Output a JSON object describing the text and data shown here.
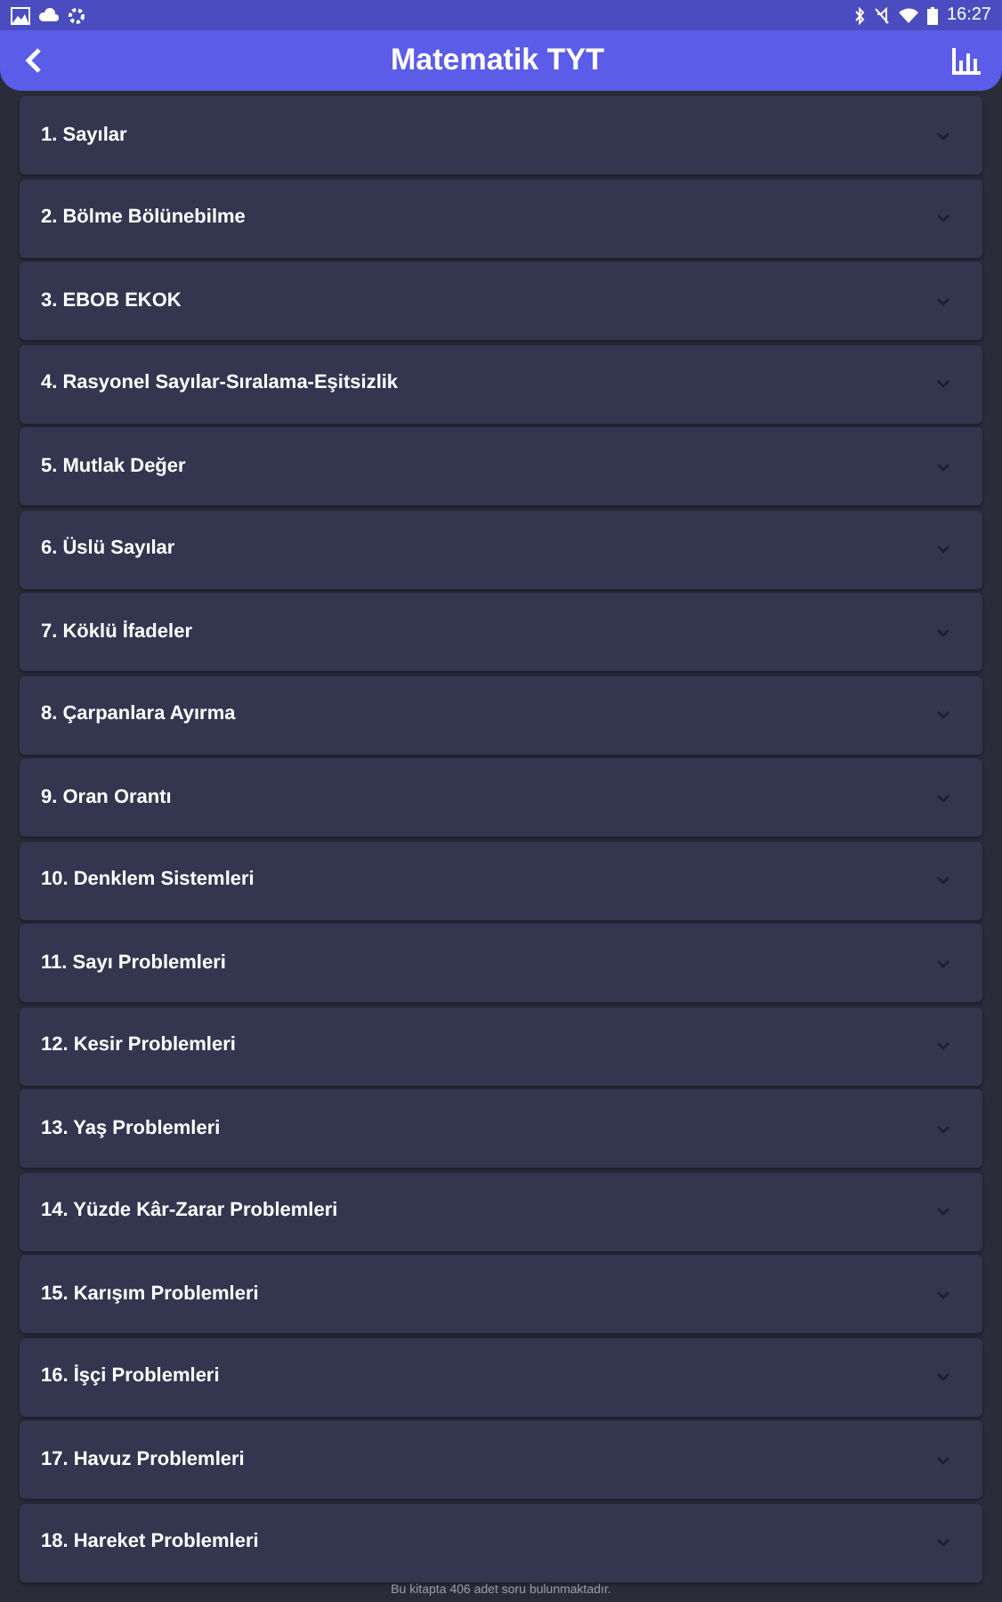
{
  "status_bar": {
    "time": "16:27"
  },
  "app_bar": {
    "title": "Matematik TYT"
  },
  "topics": [
    {
      "label": "1. Sayılar",
      "expanded": false
    },
    {
      "label": "2. Bölme Bölünebilme",
      "expanded": false
    },
    {
      "label": "3. EBOB EKOK",
      "expanded": false
    },
    {
      "label": "4. Rasyonel Sayılar-Sıralama-Eşitsizlik",
      "expanded": false
    },
    {
      "label": "5. Mutlak Değer",
      "expanded": false
    },
    {
      "label": "6. Üslü Sayılar",
      "expanded": false
    },
    {
      "label": "7. Köklü İfadeler",
      "expanded": false
    },
    {
      "label": "8. Çarpanlara Ayırma",
      "expanded": false
    },
    {
      "label": "9. Oran Orantı",
      "expanded": false
    },
    {
      "label": "10. Denklem Sistemleri",
      "expanded": false
    },
    {
      "label": "11. Sayı Problemleri",
      "expanded": false
    },
    {
      "label": "12. Kesir Problemleri",
      "expanded": false
    },
    {
      "label": "13. Yaş Problemleri",
      "expanded": false
    },
    {
      "label": "14. Yüzde Kâr-Zarar Problemleri",
      "expanded": false
    },
    {
      "label": "15. Karışım Problemleri",
      "expanded": false
    },
    {
      "label": "16. İşçi Problemleri",
      "expanded": false
    },
    {
      "label": "17. Havuz Problemleri",
      "expanded": false
    },
    {
      "label": "18. Hareket Problemleri",
      "expanded": false
    }
  ],
  "footer": "Bu kitapta 406 adet soru bulunmaktadır."
}
